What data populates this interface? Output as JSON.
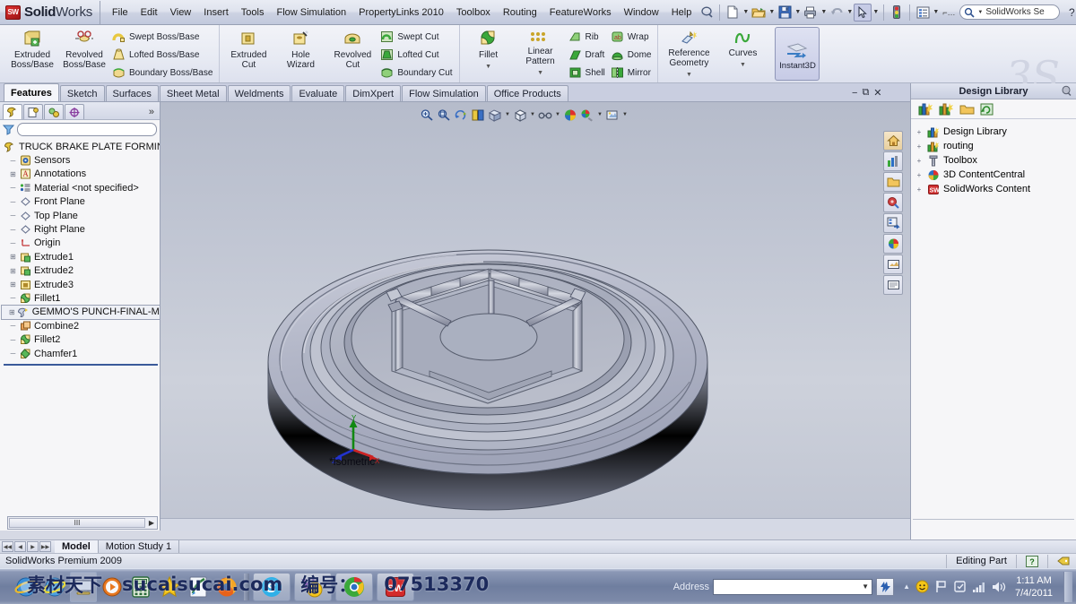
{
  "app": {
    "brand_bold": "Solid",
    "brand_light": "Works",
    "logo_text": "SW",
    "premium_status": "SolidWorks Premium 2009",
    "accent_red": "#b91c1c",
    "accent_blue": "#2a54a8"
  },
  "menubar": {
    "items": [
      "File",
      "Edit",
      "View",
      "Insert",
      "Tools",
      "Flow Simulation",
      "PropertyLinks 2010",
      "Toolbox",
      "Routing",
      "FeatureWorks",
      "Window",
      "Help"
    ],
    "icons": [
      "help-pointer-icon",
      "new-document-icon",
      "open-folder-icon",
      "save-icon",
      "print-icon",
      "undo-icon",
      "select-arrow-icon",
      "rebuild-icon",
      "options-icon",
      "file-properties-icon"
    ],
    "search_value": "SolidWorks Se",
    "search_icon": "magnifier-icon",
    "help_label": "?",
    "window_controls": [
      "minimize",
      "restore",
      "close"
    ]
  },
  "ribbon": {
    "groups": [
      {
        "name": "boss-base",
        "big": [
          {
            "label1": "Extruded",
            "label2": "Boss/Base",
            "icon": "extruded-boss-icon",
            "caret": false
          },
          {
            "label1": "Revolved",
            "label2": "Boss/Base",
            "icon": "revolved-boss-icon",
            "caret": false
          }
        ],
        "small": [
          {
            "label": "Swept Boss/Base",
            "icon": "swept-boss-icon"
          },
          {
            "label": "Lofted Boss/Base",
            "icon": "lofted-boss-icon"
          },
          {
            "label": "Boundary Boss/Base",
            "icon": "boundary-boss-icon"
          }
        ]
      },
      {
        "name": "cut",
        "big": [
          {
            "label1": "Extruded",
            "label2": "Cut",
            "icon": "extruded-cut-icon",
            "caret": false
          },
          {
            "label1": "Hole",
            "label2": "Wizard",
            "icon": "hole-wizard-icon",
            "caret": false
          },
          {
            "label1": "Revolved",
            "label2": "Cut",
            "icon": "revolved-cut-icon",
            "caret": false
          }
        ],
        "small": [
          {
            "label": "Swept Cut",
            "icon": "swept-cut-icon"
          },
          {
            "label": "Lofted Cut",
            "icon": "lofted-cut-icon"
          },
          {
            "label": "Boundary Cut",
            "icon": "boundary-cut-icon"
          }
        ]
      },
      {
        "name": "features",
        "big": [
          {
            "label1": "Fillet",
            "label2": "",
            "icon": "fillet-icon",
            "caret": true
          },
          {
            "label1": "Linear",
            "label2": "Pattern",
            "icon": "linear-pattern-icon",
            "caret": true
          }
        ],
        "small": [
          {
            "label": "Rib",
            "icon": "rib-icon"
          },
          {
            "label": "Draft",
            "icon": "draft-icon"
          },
          {
            "label": "Shell",
            "icon": "shell-icon"
          }
        ],
        "small2": [
          {
            "label": "Wrap",
            "icon": "wrap-icon"
          },
          {
            "label": "Dome",
            "icon": "dome-icon"
          },
          {
            "label": "Mirror",
            "icon": "mirror-icon"
          }
        ]
      },
      {
        "name": "reference",
        "big": [
          {
            "label1": "Reference",
            "label2": "Geometry",
            "icon": "reference-geometry-icon",
            "caret": true
          },
          {
            "label1": "Curves",
            "label2": "",
            "icon": "curves-icon",
            "caret": true
          }
        ],
        "small": []
      }
    ],
    "instant3d": {
      "label": "Instant3D",
      "icon": "instant3d-icon",
      "selected": true
    }
  },
  "command_tabs": {
    "items": [
      "Features",
      "Sketch",
      "Surfaces",
      "Sheet Metal",
      "Weldments",
      "Evaluate",
      "DimXpert",
      "Flow Simulation",
      "Office Products"
    ],
    "active": "Features",
    "window_controls": [
      "minimize",
      "restore",
      "close"
    ]
  },
  "feature_manager": {
    "tabs": [
      "feature-manager-tab",
      "property-manager-tab",
      "configuration-manager-tab",
      "dimxpert-manager-tab"
    ],
    "active_tab_index": 0,
    "more_glyph": "»",
    "filter": {
      "icon": "filter-icon",
      "placeholder": "",
      "value": ""
    },
    "tree": [
      {
        "label": "TRUCK BRAKE PLATE FORMING D",
        "icon": "part-icon",
        "expandable": false,
        "indent": 0,
        "root": true
      },
      {
        "label": "Sensors",
        "icon": "sensors-icon",
        "expandable": false,
        "indent": 1
      },
      {
        "label": "Annotations",
        "icon": "annotations-icon",
        "expandable": true,
        "indent": 1
      },
      {
        "label": "Material <not specified>",
        "icon": "material-icon",
        "expandable": false,
        "indent": 1
      },
      {
        "label": "Front Plane",
        "icon": "plane-icon",
        "expandable": false,
        "indent": 1
      },
      {
        "label": "Top Plane",
        "icon": "plane-icon",
        "expandable": false,
        "indent": 1
      },
      {
        "label": "Right Plane",
        "icon": "plane-icon",
        "expandable": false,
        "indent": 1
      },
      {
        "label": "Origin",
        "icon": "origin-icon",
        "expandable": false,
        "indent": 1
      },
      {
        "label": "Extrude1",
        "icon": "extrude-icon",
        "expandable": true,
        "indent": 1
      },
      {
        "label": "Extrude2",
        "icon": "extrude-icon",
        "expandable": true,
        "indent": 1
      },
      {
        "label": "Extrude3",
        "icon": "extrude-cut-tree-icon",
        "expandable": true,
        "indent": 1
      },
      {
        "label": "Fillet1",
        "icon": "fillet-tree-icon",
        "expandable": false,
        "indent": 1
      },
      {
        "label": "GEMMO'S PUNCH-FINAL-MA",
        "icon": "imported-body-icon",
        "expandable": true,
        "indent": 1,
        "tooltip": true
      },
      {
        "label": "Combine2",
        "icon": "combine-icon",
        "expandable": false,
        "indent": 1
      },
      {
        "label": "Fillet2",
        "icon": "fillet-tree-icon",
        "expandable": false,
        "indent": 1
      },
      {
        "label": "Chamfer1",
        "icon": "chamfer-icon",
        "expandable": false,
        "indent": 1
      }
    ],
    "hscroll_glyph": "III",
    "hscroll_arrow": "▶"
  },
  "viewport": {
    "toolbar": [
      {
        "icon": "zoom-to-fit-icon",
        "caret": false
      },
      {
        "icon": "zoom-to-area-icon",
        "caret": false
      },
      {
        "icon": "rotate-view-icon",
        "caret": false
      },
      {
        "icon": "section-view-icon",
        "caret": false
      },
      {
        "icon": "view-orientation-icon",
        "caret": true
      },
      {
        "icon": "display-style-icon",
        "caret": true
      },
      {
        "icon": "hide-show-items-icon",
        "caret": true
      },
      {
        "icon": "edit-appearance-icon",
        "caret": false
      },
      {
        "icon": "apply-scene-icon",
        "caret": true
      },
      {
        "icon": "view-settings-icon",
        "caret": true
      }
    ],
    "right_dock": [
      {
        "icon": "home-icon"
      },
      {
        "icon": "solidworks-resources-icon"
      },
      {
        "icon": "design-library-icon"
      },
      {
        "icon": "file-explorer-icon"
      },
      {
        "icon": "search-panel-icon"
      },
      {
        "icon": "view-palette-icon"
      },
      {
        "icon": "appearances-icon"
      },
      {
        "icon": "custom-properties-icon"
      }
    ],
    "orientation_label": "*Isometric",
    "triad": {
      "x_label": "X",
      "y_label": "Y",
      "z_label": "Z",
      "x_color": "#cc2222",
      "y_color": "#118811",
      "z_color": "#2233cc"
    },
    "model_name": "truck-brake-plate-forming-die"
  },
  "design_library": {
    "title": "Design Library",
    "pin_icon": "pushpin-icon",
    "toolbar": [
      {
        "icon": "add-to-library-icon"
      },
      {
        "icon": "add-file-location-icon"
      },
      {
        "icon": "create-new-folder-icon"
      },
      {
        "icon": "refresh-icon"
      }
    ],
    "tree": [
      {
        "label": "Design Library",
        "icon": "design-library-folder-icon"
      },
      {
        "label": "routing",
        "icon": "routing-folder-icon"
      },
      {
        "label": "Toolbox",
        "icon": "toolbox-icon"
      },
      {
        "label": "3D ContentCentral",
        "icon": "3d-contentcentral-icon"
      },
      {
        "label": "SolidWorks Content",
        "icon": "solidworks-content-icon"
      }
    ],
    "expander": "+"
  },
  "bottom_tabs": {
    "nav_arrows": [
      "◀◀",
      "◀",
      "▶",
      "▶▶"
    ],
    "items": [
      "Model",
      "Motion Study 1"
    ],
    "active": "Model"
  },
  "status_bar": {
    "left_text": "SolidWorks Premium 2009",
    "edit_mode": "Editing Part",
    "help_glyph": "?",
    "tag_icon": "tag-icon"
  },
  "taskbar": {
    "quick_launch": [
      {
        "icon": "internet-explorer-icon"
      },
      {
        "icon": "internet-explorer-icon"
      },
      {
        "icon": "show-desktop-icon"
      },
      {
        "icon": "media-player-icon"
      },
      {
        "icon": "calculator-icon"
      },
      {
        "icon": "star-icon"
      },
      {
        "icon": "pen-icon"
      },
      {
        "icon": "firefox-icon"
      }
    ],
    "tasks": [
      {
        "icon": "skype-icon",
        "name": "skype"
      },
      {
        "icon": "yahoo-messenger-icon",
        "name": "yahoo-messenger"
      },
      {
        "icon": "chrome-icon",
        "name": "google-chrome"
      },
      {
        "icon": "solidworks-icon",
        "name": "solidworks"
      }
    ],
    "address_label": "Address",
    "address_value": "",
    "go_icon": "go-icon",
    "tray": [
      {
        "icon": "show-hidden-icons-icon"
      },
      {
        "icon": "yahoo-messenger-tray-icon"
      },
      {
        "icon": "flag-icon"
      },
      {
        "icon": "action-center-icon"
      },
      {
        "icon": "network-signal-icon"
      },
      {
        "icon": "volume-icon"
      }
    ],
    "time": "1:11 AM",
    "date": "7/4/2011"
  },
  "watermark": {
    "text_cn": "素材天下",
    "text_site": "sucaisucai.com",
    "text_num_label": "编号：",
    "text_num": "07513370"
  }
}
